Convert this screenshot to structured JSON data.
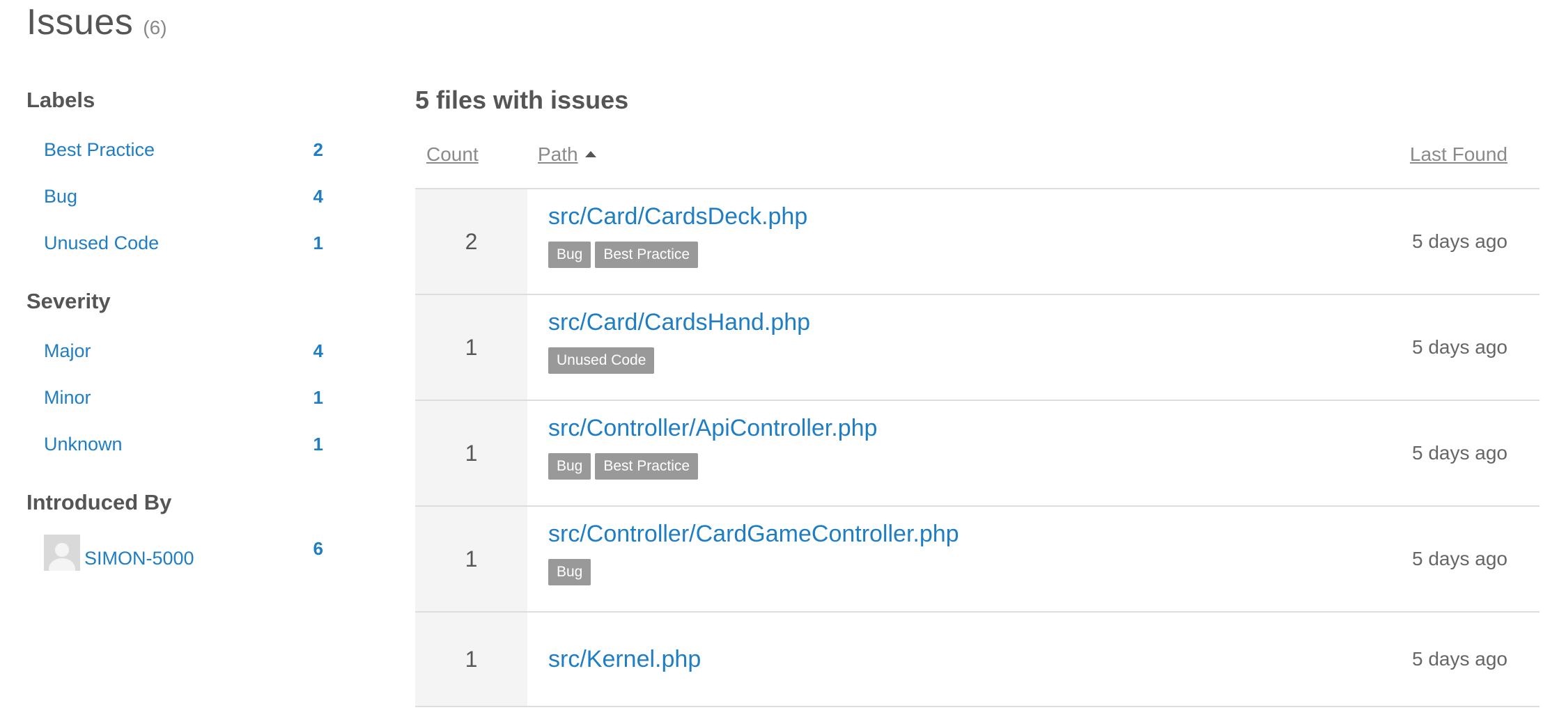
{
  "header": {
    "title": "Issues",
    "count": "(6)"
  },
  "sidebar": {
    "labels": {
      "heading": "Labels",
      "items": [
        {
          "label": "Best Practice",
          "count": "2"
        },
        {
          "label": "Bug",
          "count": "4"
        },
        {
          "label": "Unused Code",
          "count": "1"
        }
      ]
    },
    "severity": {
      "heading": "Severity",
      "items": [
        {
          "label": "Major",
          "count": "4"
        },
        {
          "label": "Minor",
          "count": "1"
        },
        {
          "label": "Unknown",
          "count": "1"
        }
      ]
    },
    "introduced_by": {
      "heading": "Introduced By",
      "user": {
        "name": "SIMON-5000",
        "count": "6"
      }
    }
  },
  "main": {
    "heading": "5 files with issues",
    "columns": {
      "count": "Count",
      "path": "Path",
      "last_found": "Last Found"
    },
    "rows": [
      {
        "count": "2",
        "path": "src/Card/CardsDeck.php",
        "tags": [
          "Bug",
          "Best Practice"
        ],
        "last_found": "5 days ago"
      },
      {
        "count": "1",
        "path": "src/Card/CardsHand.php",
        "tags": [
          "Unused Code"
        ],
        "last_found": "5 days ago"
      },
      {
        "count": "1",
        "path": "src/Controller/ApiController.php",
        "tags": [
          "Bug",
          "Best Practice"
        ],
        "last_found": "5 days ago"
      },
      {
        "count": "1",
        "path": "src/Controller/CardGameController.php",
        "tags": [
          "Bug"
        ],
        "last_found": "5 days ago"
      },
      {
        "count": "1",
        "path": "src/Kernel.php",
        "tags": [],
        "last_found": "5 days ago"
      }
    ]
  }
}
